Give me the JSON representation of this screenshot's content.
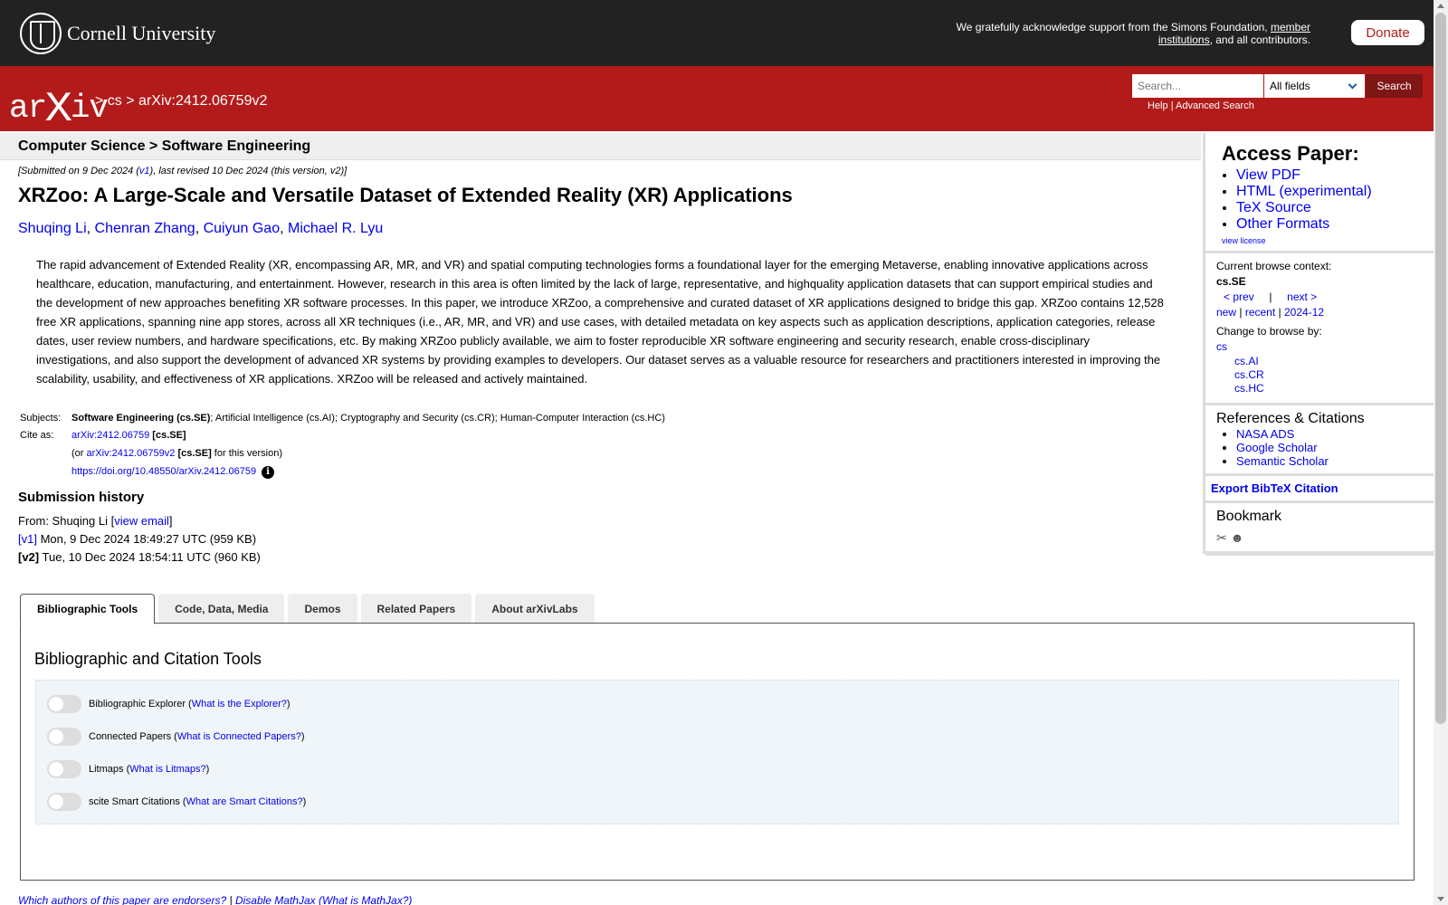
{
  "header": {
    "university": "Cornell University",
    "ack_text": "We gratefully acknowledge support from the Simons Foundation,",
    "ack_link": "member institutions",
    "ack_tail": ", and all contributors.",
    "donate": "Donate"
  },
  "nav": {
    "logo": "arXiv",
    "crumb_sep1": ">",
    "crumb_cs": "cs",
    "crumb_sep2": ">",
    "crumb_id": "arXiv:2412.06759v2",
    "search_placeholder": "Search...",
    "field_select": "All fields",
    "search_button": "Search",
    "help": "Help",
    "help_sep": "|",
    "advanced": "Advanced Search"
  },
  "paper": {
    "subject_header": "Computer Science > Software Engineering",
    "submitted_prefix": "[Submitted on 9 Dec 2024 (",
    "submitted_v1": "v1",
    "submitted_suffix": "), last revised 10 Dec 2024 (this version, v2)]",
    "title": "XRZoo: A Large-Scale and Versatile Dataset of Extended Reality (XR) Applications",
    "authors": [
      "Shuqing Li",
      "Chenran Zhang",
      "Cuiyun Gao",
      "Michael R. Lyu"
    ],
    "abstract": "The rapid advancement of Extended Reality (XR, encompassing AR, MR, and VR) and spatial computing technologies forms a foundational layer for the emerging Metaverse, enabling innovative applications across healthcare, education, manufacturing, and entertainment. However, research in this area is often limited by the lack of large, representative, and highquality application datasets that can support empirical studies and the development of new approaches benefiting XR software processes. In this paper, we introduce XRZoo, a comprehensive and curated dataset of XR applications designed to bridge this gap. XRZoo contains 12,528 free XR applications, spanning nine app stores, across all XR techniques (i.e., AR, MR, and VR) and use cases, with detailed metadata on key aspects such as application descriptions, application categories, release dates, user review numbers, and hardware specifications, etc. By making XRZoo publicly available, we aim to foster reproducible XR software engineering and security research, enable cross-disciplinary investigations, and also support the development of advanced XR systems by providing examples to developers. Our dataset serves as a valuable resource for researchers and practitioners interested in improving the scalability, usability, and effectiveness of XR applications. XRZoo will be released and actively maintained.",
    "subjects_label": "Subjects:",
    "subjects_primary": "Software Engineering (cs.SE)",
    "subjects_rest": "; Artificial Intelligence (cs.AI); Cryptography and Security (cs.CR); Human-Computer Interaction (cs.HC)",
    "cite_label": "Cite as:",
    "cite_id": "arXiv:2412.06759",
    "cite_cat": "[cs.SE]",
    "cite_or": "(or",
    "cite_version": "arXiv:2412.06759v2",
    "cite_version_cat": "[cs.SE]",
    "cite_version_tail": "for this version)",
    "doi": "https://doi.org/10.48550/arXiv.2412.06759",
    "doi_info": "i"
  },
  "history": {
    "title": "Submission history",
    "from_prefix": "From: Shuqing Li [",
    "view_email": "view email",
    "from_suffix": "]",
    "v1_label": "[v1]",
    "v1_text": "Mon, 9 Dec 2024 18:49:27 UTC (959 KB)",
    "v2_label": "[v2]",
    "v2_text": "Tue, 10 Dec 2024 18:54:11 UTC (960 KB)"
  },
  "sidebar": {
    "access_title": "Access Paper:",
    "access_links": [
      "View PDF",
      "HTML (experimental)",
      "TeX Source",
      "Other Formats"
    ],
    "view_license": "view license",
    "current_context_label": "Current browse context:",
    "current_context": "cs.SE",
    "prev": "< prev",
    "sep": "|",
    "next": "next >",
    "new": "new",
    "recent": "recent",
    "month": "2024-12",
    "change_browse": "Change to browse by:",
    "browse_cs": "cs",
    "browse_sub": [
      "cs.AI",
      "cs.CR",
      "cs.HC"
    ],
    "refs_title": "References & Citations",
    "refs_links": [
      "NASA ADS",
      "Google Scholar",
      "Semantic Scholar"
    ],
    "export_bibtex": "Export BibTeX Citation",
    "bookmark_title": "Bookmark"
  },
  "tabs": [
    "Bibliographic Tools",
    "Code, Data, Media",
    "Demos",
    "Related Papers",
    "About arXivLabs"
  ],
  "tools": {
    "heading": "Bibliographic and Citation Tools",
    "rows": [
      {
        "label": "Bibliographic Explorer",
        "link": "What is the Explorer?"
      },
      {
        "label": "Connected Papers",
        "link": "What is Connected Papers?"
      },
      {
        "label": "Litmaps",
        "link": "What is Litmaps?"
      },
      {
        "label": "scite Smart Citations",
        "link": "What are Smart Citations?"
      }
    ]
  },
  "footer": {
    "endorsers": "Which authors of this paper are endorsers?",
    "sep": "|",
    "disable_mathjax": "Disable MathJax",
    "what_mathjax": "(What is MathJax?)"
  }
}
